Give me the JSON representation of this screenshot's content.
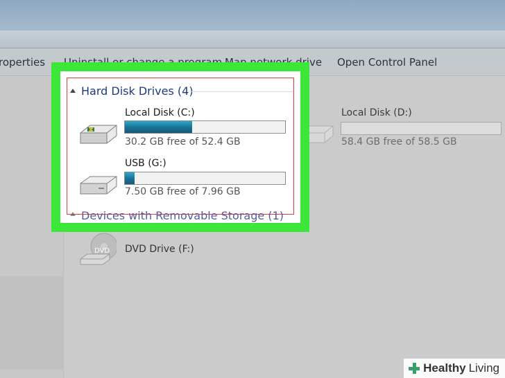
{
  "toolbar": {
    "properties": "roperties",
    "uninstall": "Uninstall or change a program",
    "map_drive": "Map network drive",
    "control_panel": "Open Control Panel"
  },
  "groups": {
    "hard_disks": "Hard Disk Drives (4)",
    "removable": "Devices with Removable Storage (1)"
  },
  "drives": {
    "c": {
      "name": "Local Disk (C:)",
      "free": "30.2 GB free of 52.4 GB",
      "used_fraction": 0.42
    },
    "g": {
      "name": "USB (G:)",
      "free": "7.50 GB free of 7.96 GB",
      "used_fraction": 0.06
    },
    "d": {
      "name": "Local Disk (D:)",
      "free": "58.4 GB free of 58.5 GB",
      "used_fraction": 0.0
    },
    "f": {
      "name": "DVD Drive (F:)",
      "icon_label": "DVD"
    }
  },
  "watermark": {
    "word1": "Healthy",
    "word2": "Living"
  },
  "colors": {
    "highlight_frame": "#3be83a",
    "selection_box": "#e03a3a",
    "bar_fill": "#1b6f93"
  },
  "icons": [
    "hard-drive-icon",
    "dvd-drive-icon",
    "collapse-triangle-icon",
    "healthy-living-plus-icon"
  ]
}
